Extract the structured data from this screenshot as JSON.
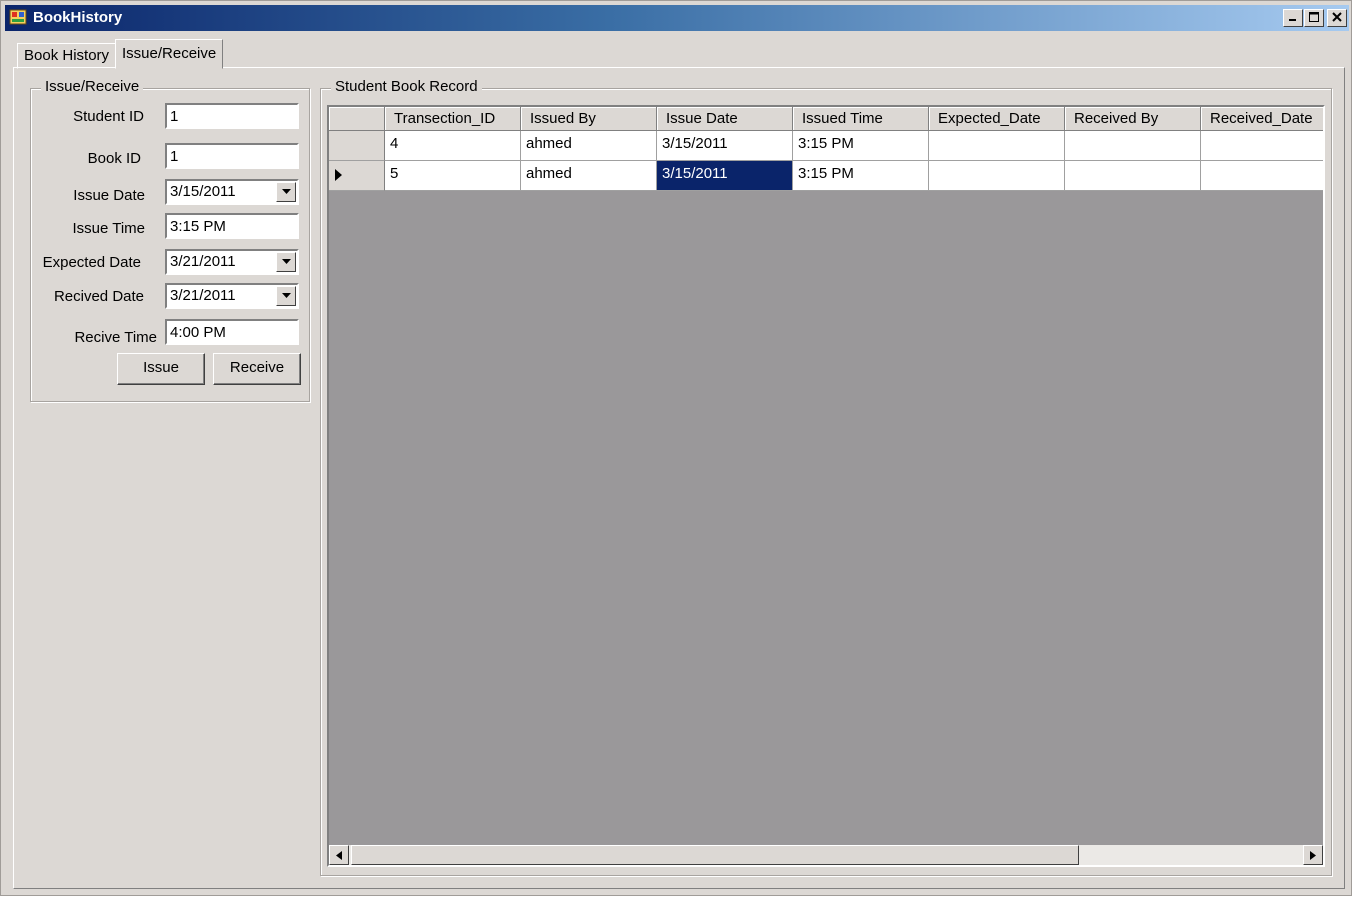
{
  "window": {
    "title": "BookHistory"
  },
  "tabs": [
    {
      "label": "Book History"
    },
    {
      "label": "Issue/Receive",
      "active": true
    }
  ],
  "form": {
    "group_title": "Issue/Receive",
    "student_id": {
      "label": "Student ID",
      "value": "1"
    },
    "book_id": {
      "label": "Book ID",
      "value": "1"
    },
    "issue_date": {
      "label": "Issue Date",
      "value": "3/15/2011"
    },
    "issue_time": {
      "label": "Issue Time",
      "value": "3:15 PM"
    },
    "expected_date": {
      "label": "Expected Date",
      "value": "3/21/2011"
    },
    "received_date": {
      "label": "Recived Date",
      "value": "3/21/2011"
    },
    "receive_time": {
      "label": "Recive Time",
      "value": "4:00 PM"
    },
    "issue_button": "Issue",
    "receive_button": "Receive"
  },
  "record": {
    "group_title": "Student Book Record",
    "columns": [
      "Transection_ID",
      "Issued By",
      "Issue Date",
      "Issued Time",
      "Expected_Date",
      "Received By",
      "Received_Date"
    ],
    "rows": [
      [
        "4",
        "ahmed",
        "3/15/2011",
        "3:15 PM",
        "",
        "",
        ""
      ],
      [
        "5",
        "ahmed",
        "3/15/2011",
        "3:15 PM",
        "",
        "",
        ""
      ]
    ],
    "current_row": 1,
    "selected_cell": {
      "row": 1,
      "column": 2
    }
  },
  "icons": {
    "app": "app-icon",
    "minimize": "minimize-icon",
    "maximize": "maximize-icon",
    "close": "close-icon",
    "dropdown": "chevron-down-icon",
    "row_indicator": "row-pointer-icon",
    "scroll_left": "arrow-left-icon",
    "scroll_right": "arrow-right-icon"
  },
  "colors": {
    "title_gradient_start": "#0a246a",
    "title_gradient_end": "#a6caf0",
    "face": "#dcd8d4",
    "grid_background": "#9a989a",
    "selection": "#0a246a"
  }
}
